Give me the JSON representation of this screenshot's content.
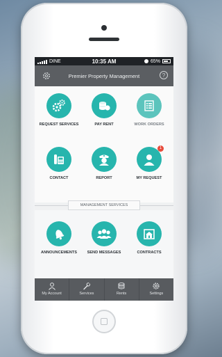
{
  "status_bar": {
    "carrier": "DINE",
    "time": "10:35 AM",
    "battery": "65%"
  },
  "header": {
    "title": "Premier Property Management",
    "help_symbol": "?"
  },
  "main_tiles": [
    {
      "label": "REQUEST SERVICES",
      "icon": "gears-icon"
    },
    {
      "label": "PAY RENT",
      "icon": "coins-icon"
    },
    {
      "label": "WORK ORDERS",
      "icon": "list-icon"
    },
    {
      "label": "CONTACT",
      "icon": "phone-icon"
    },
    {
      "label": "REPORT",
      "icon": "officer-icon"
    },
    {
      "label": "MY REQUEST",
      "icon": "person-icon",
      "badge": "1"
    }
  ],
  "section": {
    "title": "MANAGEMENT SERVICES"
  },
  "service_tiles": [
    {
      "label": "ANNOUNCEMENTS",
      "icon": "bell-icon"
    },
    {
      "label": "SEND MESSAGES",
      "icon": "group-icon"
    },
    {
      "label": "CONTRACTS",
      "icon": "house-icon"
    }
  ],
  "tabs": [
    {
      "label": "My Account",
      "icon": "user-icon"
    },
    {
      "label": "Services",
      "icon": "wrench-icon"
    },
    {
      "label": "Rents",
      "icon": "coins-icon"
    },
    {
      "label": "Settings",
      "icon": "gear-icon"
    }
  ],
  "colors": {
    "accent": "#27b5ad",
    "header": "#5b5e62",
    "tabbar": "#585b5f",
    "badge": "#e74c3c"
  }
}
